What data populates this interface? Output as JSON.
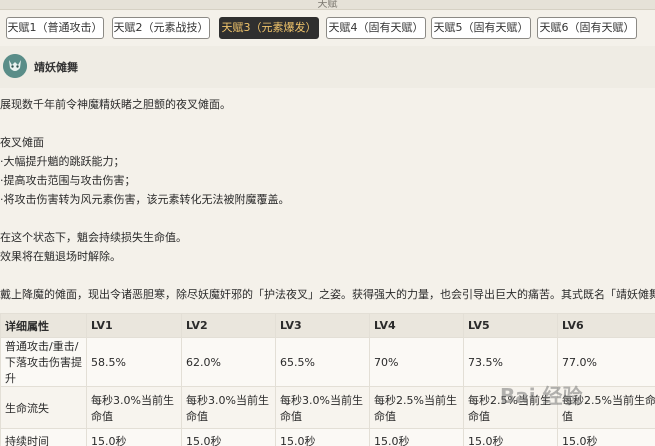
{
  "window": {
    "title": "天赋"
  },
  "tabs": [
    {
      "label": "天赋1（普通攻击）"
    },
    {
      "label": "天赋2（元素战技）"
    },
    {
      "label": "天赋3（元素爆发）"
    },
    {
      "label": "天赋4（固有天赋）"
    },
    {
      "label": "天赋5（固有天赋）"
    },
    {
      "label": "天赋6（固有天赋）"
    }
  ],
  "active_tab_index": 2,
  "skill": {
    "name": "靖妖傩舞"
  },
  "description": {
    "line1": "展现数千年前令神魔精妖睹之胆颤的夜叉傩面。",
    "line2": "夜叉傩面",
    "line3": "·大幅提升魈的跳跃能力；",
    "line4": "·提高攻击范围与攻击伤害；",
    "line5": "·将攻击伤害转为风元素伤害，该元素转化无法被附魔覆盖。",
    "line6": "在这个状态下，魈会持续损失生命值。",
    "line7": "效果将在魈退场时解除。",
    "line8": "戴上降魔的傩面，现出令诸恶胆寒，除尽妖魔奸邪的「护法夜叉」之姿。获得强大的力量，也会引导出巨大的痛苦。其式既名「靖妖傩舞"
  },
  "stats_table": {
    "headers": [
      "详细属性",
      "LV1",
      "LV2",
      "LV3",
      "LV4",
      "LV5",
      "LV6"
    ],
    "rows": [
      {
        "label": "普通攻击/重击/下落攻击伤害提升",
        "values": [
          "58.5%",
          "62.0%",
          "65.5%",
          "70%",
          "73.5%",
          "77.0%"
        ]
      },
      {
        "label": "生命流失",
        "values": [
          "每秒3.0%当前生命值",
          "每秒3.0%当前生命值",
          "每秒3.0%当前生命值",
          "每秒2.5%当前生命值",
          "每秒2.5%当前生命值",
          "每秒2.5%当前生命值"
        ]
      },
      {
        "label": "持续时间",
        "values": [
          "15.0秒",
          "15.0秒",
          "15.0秒",
          "15.0秒",
          "15.0秒",
          "15.0秒"
        ]
      }
    ]
  },
  "watermark": {
    "text": "Bai 经验"
  },
  "colors": {
    "active_tab_bg": "#2f2f2f",
    "active_tab_text": "#f0c46b",
    "avatar": "#5a8d88"
  }
}
